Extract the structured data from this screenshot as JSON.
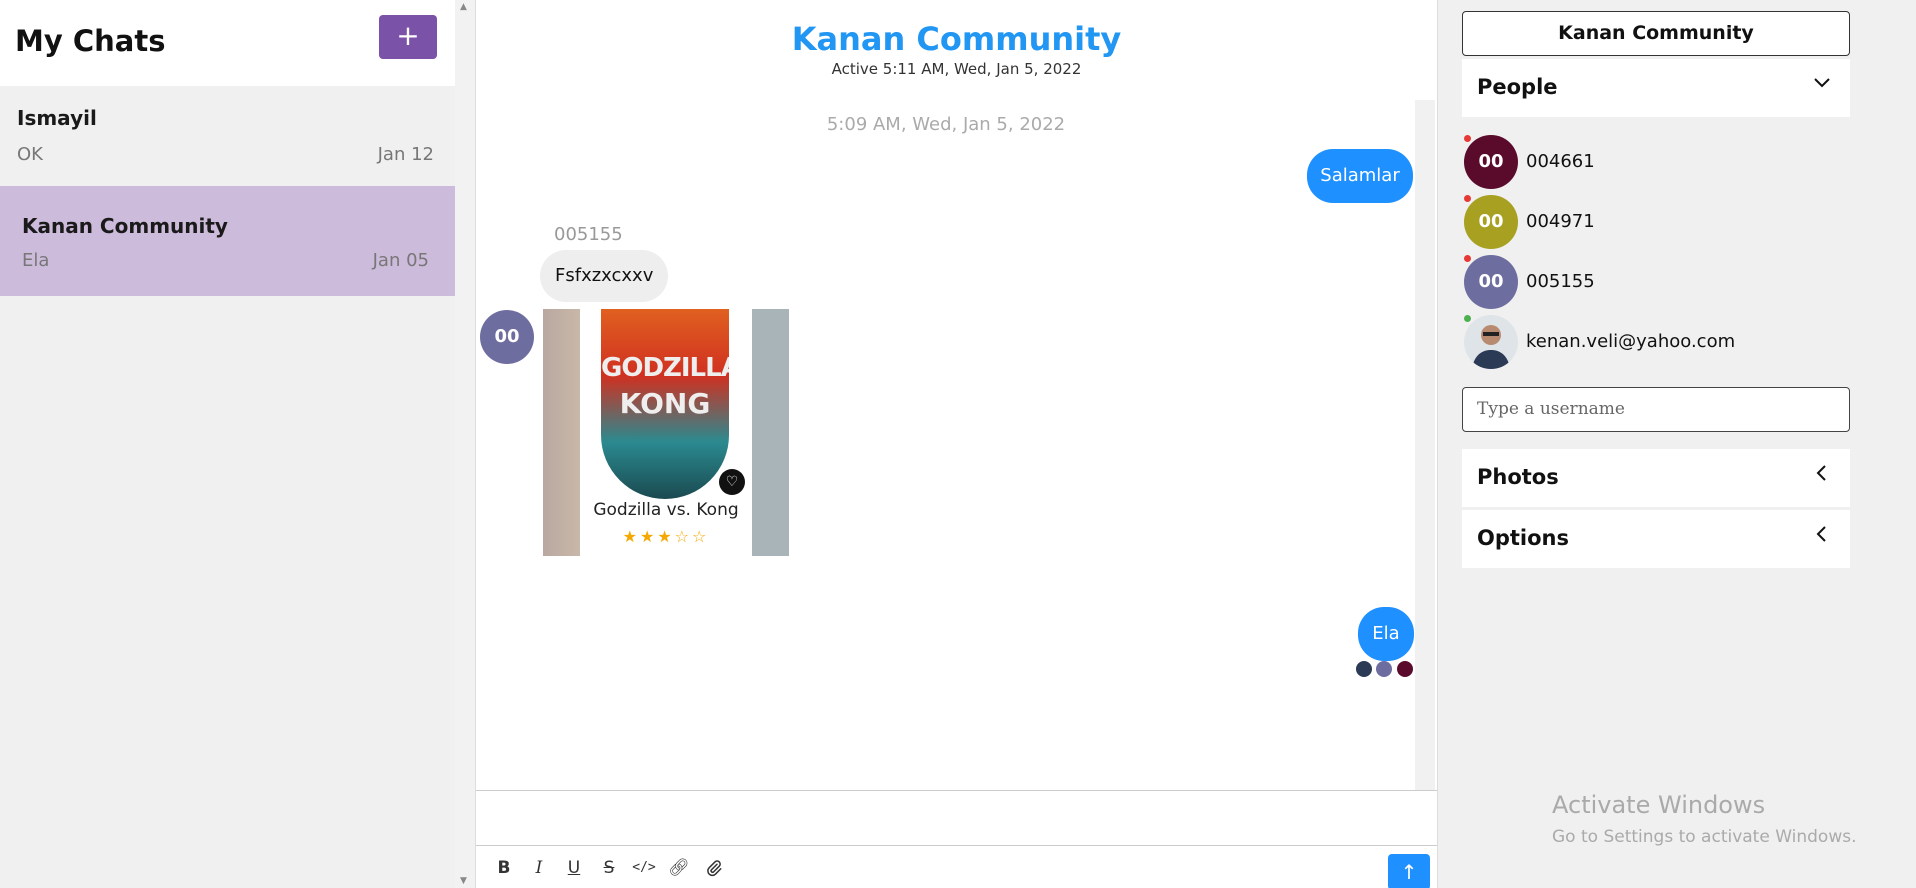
{
  "left": {
    "title": "My Chats",
    "add_label": "+",
    "chats": [
      {
        "name": "Ismayil",
        "last": "OK",
        "date": "Jan 12"
      },
      {
        "name": "Kanan Community",
        "last": "Ela",
        "date": "Jan 05"
      }
    ]
  },
  "chat": {
    "title": "Kanan Community",
    "subtitle": "Active 5:11 AM, Wed, Jan 5, 2022",
    "timestamp": "5:09 AM, Wed, Jan 5, 2022",
    "messages": [
      {
        "text": "Salamlar"
      },
      {
        "sender": "005155",
        "text": "Fsfxzxcxxv"
      },
      {
        "avatar": "00",
        "image_title": "Godzilla vs. Kong",
        "poster_line1": "GODZILLA",
        "poster_line2": "KONG",
        "rating": 3,
        "rating_max": 5,
        "stars": "★★★☆☆"
      },
      {
        "text": "Ela"
      }
    ],
    "read_receipt_colors": [
      "#2b3a55",
      "#6e6da0",
      "#5a0a2a"
    ]
  },
  "toolbar": {
    "send_icon": "arrow-up-icon",
    "tools": [
      "bold-icon",
      "italic-icon",
      "underline-icon",
      "strikethrough-icon",
      "code-icon",
      "link-icon",
      "attachment-icon"
    ]
  },
  "right": {
    "title": "Kanan Community",
    "people_label": "People",
    "people": [
      {
        "initials": "00",
        "name": "004661",
        "color": "#5a0a2a",
        "online": false
      },
      {
        "initials": "00",
        "name": "004971",
        "color": "#a8a020",
        "online": false
      },
      {
        "initials": "00",
        "name": "005155",
        "color": "#6e6da0",
        "online": false
      },
      {
        "initials": "",
        "name": "kenan.veli@yahoo.com",
        "color": "#cfd6dc",
        "online": true
      }
    ],
    "username_placeholder": "Type a username",
    "photos_label": "Photos",
    "options_label": "Options"
  },
  "watermark": {
    "line1": "Activate Windows",
    "line2": "Go to Settings to activate Windows."
  },
  "colors": {
    "accent": "#2196f3",
    "bubble": "#1e90ff",
    "add_button": "#7a52a8",
    "selected_chat": "#cdbbdb"
  }
}
